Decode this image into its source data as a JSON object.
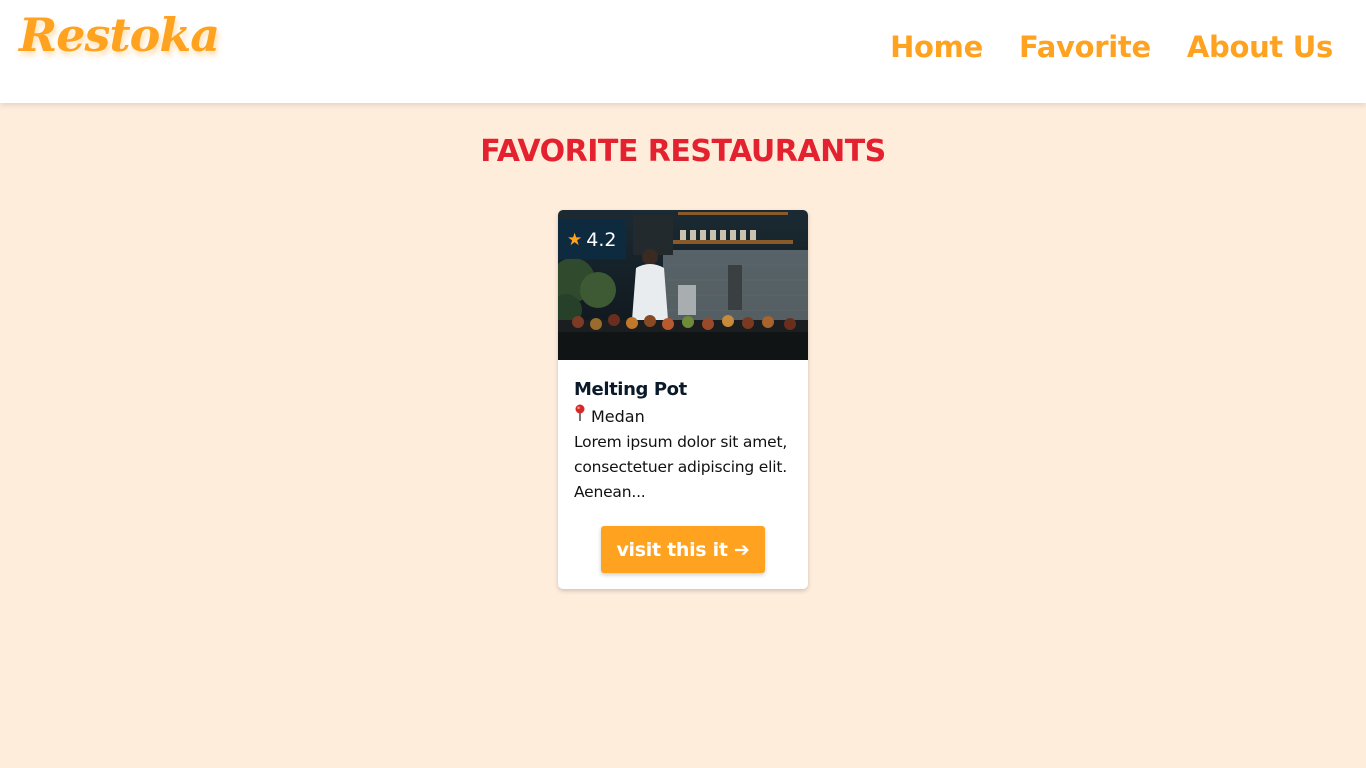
{
  "header": {
    "logo": "Restoka",
    "nav": [
      "Home",
      "Favorite",
      "About Us"
    ]
  },
  "main": {
    "title": "FAVORITE RESTAURANTS",
    "cards": [
      {
        "rating": "4.2",
        "name": "Melting Pot",
        "city": "Medan",
        "description": "Lorem ipsum dolor sit amet, consectetuer adipiscing elit. Aenean...",
        "button_label": "visit this it ➔"
      }
    ]
  },
  "colors": {
    "accent": "#FFA21F",
    "title_red": "#E4212F",
    "background": "#FFEDDC",
    "rating_bg": "#0E2A3E"
  },
  "icons": [
    "star-icon",
    "location-pin-icon",
    "arrow-right-icon"
  ]
}
